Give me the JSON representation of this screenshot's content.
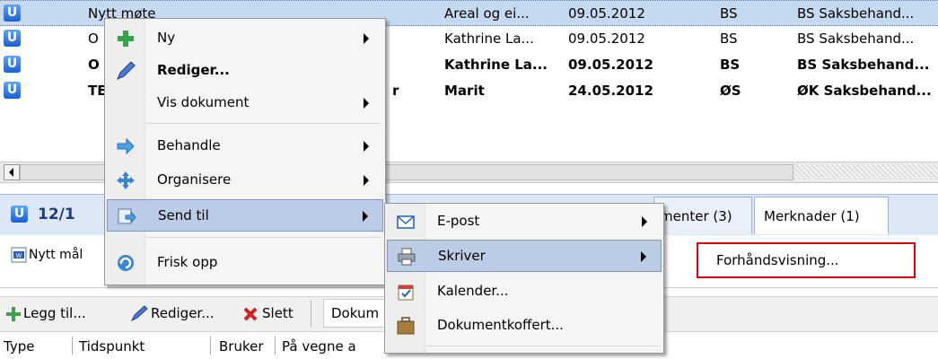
{
  "rows": [
    {
      "title": "Nytt møte",
      "col2": "Areal og ei...",
      "date": "09.05.2012",
      "unit": "BS",
      "role": "BS Saksbehand...",
      "bold": false,
      "selected": true
    },
    {
      "title": "O",
      "col2": "Kathrine La...",
      "date": "09.05.2012",
      "unit": "BS",
      "role": "BS Saksbehand...",
      "bold": false,
      "selected": false
    },
    {
      "title": "O",
      "col2": "Kathrine La...",
      "date": "09.05.2012",
      "unit": "BS",
      "role": "BS Saksbehand...",
      "bold": true,
      "selected": false
    },
    {
      "title": "TE",
      "title_tail": "r",
      "col2": "Marit",
      "date": "24.05.2012",
      "unit": "ØS",
      "role": "ØK Saksbehand...",
      "bold": true,
      "selected": false
    }
  ],
  "row_icon_letter": "U",
  "panel": {
    "case_no": "12/1",
    "tabs": [
      {
        "label": "menter (3)"
      },
      {
        "label": "Merknader (1)"
      }
    ]
  },
  "attachment": {
    "label": "Nytt mål"
  },
  "toolbar": {
    "add": "Legg til...",
    "edit": "Rediger...",
    "delete": "Slett",
    "documents": "Dokum"
  },
  "columns": [
    "Type",
    "Tidspunkt",
    "Bruker",
    "På vegne a"
  ],
  "context_menu": {
    "items": [
      {
        "label": "Ny",
        "icon": "plus-icon",
        "submenu": true,
        "bold": false
      },
      {
        "label": "Rediger...",
        "icon": "pencil-icon",
        "submenu": false,
        "bold": true
      },
      {
        "label": "Vis dokument",
        "icon": "",
        "submenu": true,
        "bold": false
      },
      {
        "label": "Behandle",
        "icon": "arrow-right-icon",
        "submenu": true,
        "bold": false
      },
      {
        "label": "Organisere",
        "icon": "move-icon",
        "submenu": true,
        "bold": false
      },
      {
        "label": "Send til",
        "icon": "send-icon",
        "submenu": true,
        "bold": false,
        "highlighted": true
      },
      {
        "label": "Frisk opp",
        "icon": "refresh-icon",
        "submenu": false,
        "bold": false
      }
    ]
  },
  "send_submenu": {
    "items": [
      {
        "label": "E-post",
        "icon": "envelope-icon",
        "submenu": true
      },
      {
        "label": "Skriver",
        "icon": "printer-icon",
        "submenu": true,
        "highlighted": true
      },
      {
        "label": "Kalender...",
        "icon": "calendar-icon",
        "submenu": false
      },
      {
        "label": "Dokumentkoffert...",
        "icon": "briefcase-icon",
        "submenu": false
      }
    ]
  },
  "printer_submenu": {
    "items": [
      {
        "label": "Forhåndsvisning..."
      }
    ]
  },
  "colors": {
    "selection": "#c5d9f1",
    "menu_highlight": "#bccce6",
    "annotation_box": "#e00000"
  }
}
